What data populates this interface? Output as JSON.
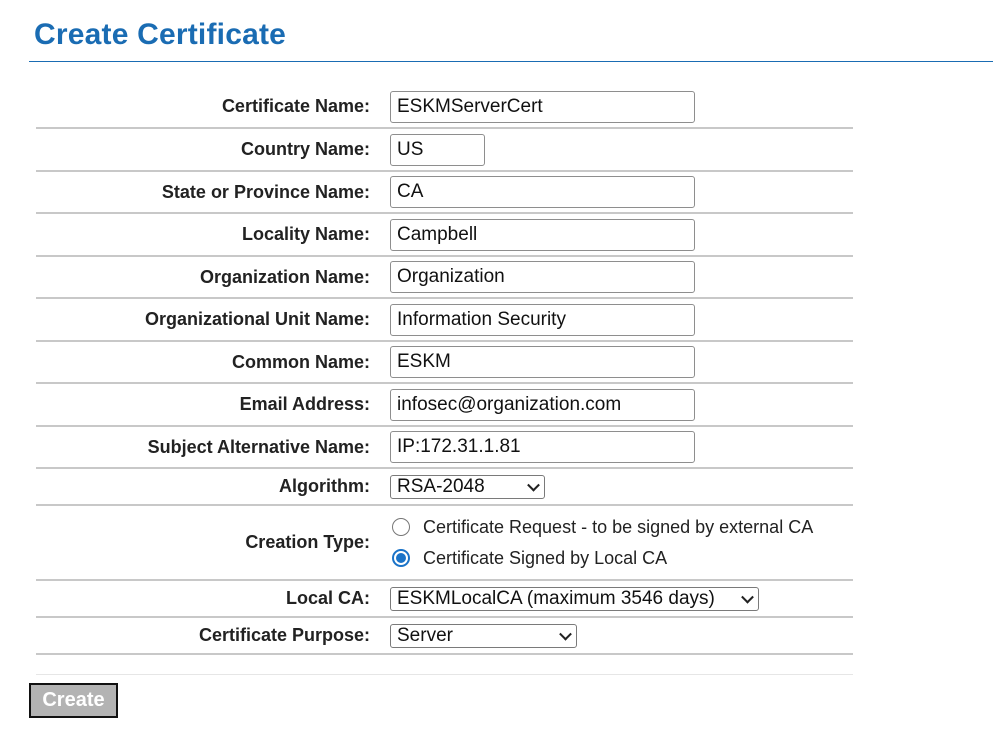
{
  "page": {
    "title": "Create Certificate"
  },
  "form": {
    "certificate_name": {
      "label": "Certificate Name:",
      "value": "ESKMServerCert"
    },
    "country_name": {
      "label": "Country Name:",
      "value": "US"
    },
    "state_name": {
      "label": "State or Province Name:",
      "value": "CA"
    },
    "locality_name": {
      "label": "Locality Name:",
      "value": "Campbell"
    },
    "organization_name": {
      "label": "Organization Name:",
      "value": "Organization"
    },
    "org_unit_name": {
      "label": "Organizational Unit Name:",
      "value": "Information Security"
    },
    "common_name": {
      "label": "Common Name:",
      "value": "ESKM"
    },
    "email_address": {
      "label": "Email Address:",
      "value": "infosec@organization.com"
    },
    "subject_alt_name": {
      "label": "Subject Alternative Name:",
      "value": "IP:172.31.1.81"
    },
    "algorithm": {
      "label": "Algorithm:",
      "selected": "RSA-2048"
    },
    "creation_type": {
      "label": "Creation Type:",
      "options": [
        {
          "label": "Certificate Request - to be signed by external CA",
          "checked": false
        },
        {
          "label": "Certificate Signed by Local CA",
          "checked": true
        }
      ]
    },
    "local_ca": {
      "label": "Local CA:",
      "selected": "ESKMLocalCA (maximum 3546 days)"
    },
    "certificate_purpose": {
      "label": "Certificate Purpose:",
      "selected": "Server"
    }
  },
  "actions": {
    "create_label": "Create"
  },
  "colors": {
    "title": "#1a6cb3",
    "radio_accent": "#1a73c8",
    "button_bg": "#b3b3b3"
  }
}
